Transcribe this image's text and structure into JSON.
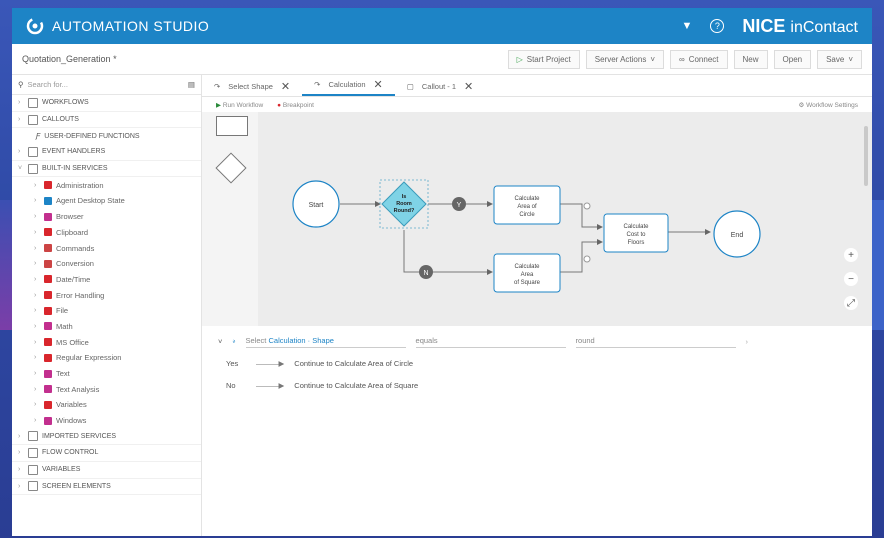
{
  "app": {
    "title": "AUTOMATION STUDIO",
    "brand": "NICE",
    "brand_sub": "inContact"
  },
  "project": {
    "name": "Quotation_Generation *",
    "buttons": [
      "Start Project",
      "Server Actions",
      "Connect",
      "New",
      "Open",
      "Save"
    ]
  },
  "sidebar": {
    "search_placeholder": "Search for...",
    "sections_top": [
      "WORKFLOWS",
      "CALLOUTS"
    ],
    "udf": "USER-DEFINED FUNCTIONS",
    "sections_mid": [
      "EVENT HANDLERS",
      "BUILT-IN SERVICES"
    ],
    "services": [
      "Administration",
      "Agent Desktop State",
      "Browser",
      "Clipboard",
      "Commands",
      "Conversion",
      "Date/Time",
      "Error Handling",
      "File",
      "Math",
      "MS Office",
      "Regular Expression",
      "Text",
      "Text Analysis",
      "Variables",
      "Windows"
    ],
    "sections_bottom": [
      "IMPORTED SERVICES",
      "FLOW CONTROL",
      "VARIABLES",
      "SCREEN ELEMENTS"
    ]
  },
  "tabs": [
    {
      "label": "Select Shape"
    },
    {
      "label": "Calculation"
    },
    {
      "label": "Callout - 1"
    }
  ],
  "runbar": {
    "run": "Run Workflow",
    "breakpoint": "Breakpoint",
    "settings": "Workflow Settings"
  },
  "flow": {
    "start": "Start",
    "decision": "Is Room Round?",
    "yes": "Y",
    "no": "N",
    "circle": "Calculate Area of Circle",
    "square": "Calculate Area of Square",
    "floor": "Calculate Cost to Floors",
    "end": "End"
  },
  "props": {
    "select_label": "Select",
    "select_value": "Calculation · Shape",
    "equals": "equals",
    "round": "round",
    "rows": [
      {
        "key": "Yes",
        "text": "Continue to Calculate Area of Circle"
      },
      {
        "key": "No",
        "text": "Continue to Calculate Area of Square"
      }
    ]
  },
  "colors": {
    "titlebar": "#1d84c6",
    "decision": "#7fd3e6",
    "canvas": "#ececec"
  }
}
